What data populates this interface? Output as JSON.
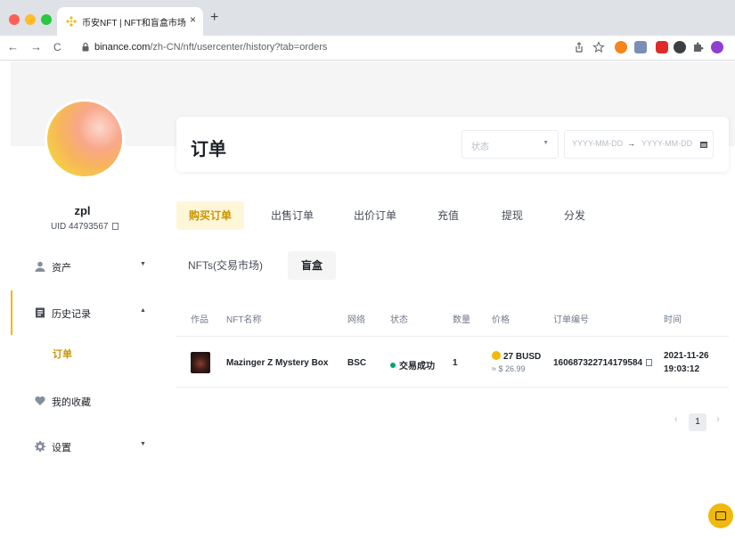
{
  "browser": {
    "tab_title": "币安NFT | NFT和盲盒市场",
    "tab_close": "×",
    "new_tab": "+",
    "url_domain": "binance.com",
    "url_path": "/zh-CN/nft/usercenter/history?tab=orders",
    "back": "←",
    "forward": "→",
    "reload": "C"
  },
  "profile": {
    "username": "zpl",
    "uid": "UID 44793567"
  },
  "sidebar": {
    "items": [
      {
        "label": "资产",
        "arrow": "▼"
      },
      {
        "label": "历史记录",
        "arrow": "▲"
      },
      {
        "label": "我的收藏"
      },
      {
        "label": "设置",
        "arrow": "▼"
      }
    ],
    "sub_item": "订单"
  },
  "header": {
    "title": "订单",
    "status_placeholder": "状态",
    "status_caret": "▼",
    "date_start": "YYYY-MM-DD",
    "date_arrow": "→",
    "date_end": "YYYY-MM-DD"
  },
  "tabs": [
    "购买订单",
    "出售订单",
    "出价订单",
    "充值",
    "提现",
    "分发"
  ],
  "subtabs": [
    "NFTs(交易市场)",
    "盲盒"
  ],
  "table": {
    "headers": [
      "作品",
      "NFT名称",
      "网络",
      "状态",
      "数量",
      "价格",
      "订单编号",
      "时间"
    ],
    "rows": [
      {
        "name": "Mazinger Z Mystery Box",
        "network": "BSC",
        "status": "交易成功",
        "quantity": "1",
        "price": "27 BUSD",
        "price_usd": "≈ $ 26.99",
        "order_id": "160687322714179584",
        "date": "2021-11-26",
        "time": "19:03:12"
      }
    ]
  },
  "pagination": {
    "prev": "‹",
    "current": "1",
    "next": "›"
  },
  "colors": {
    "accent": "#f0b90b",
    "accent_text": "#c99400",
    "success": "#03a66d"
  }
}
